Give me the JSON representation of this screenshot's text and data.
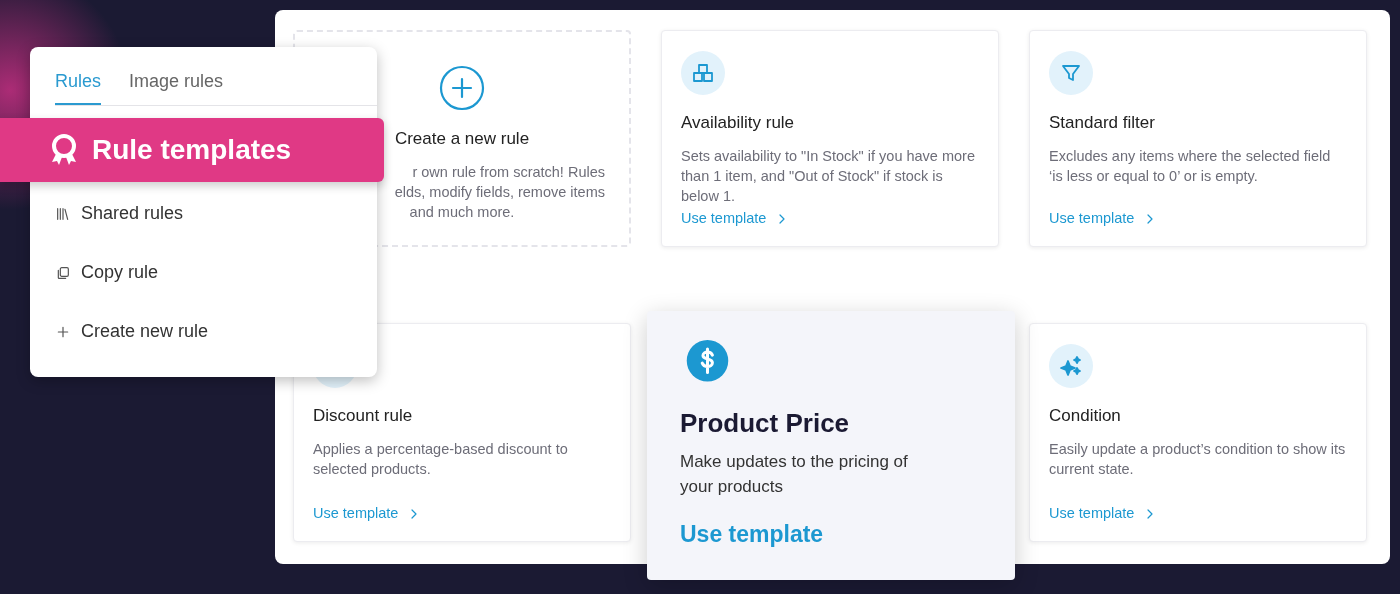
{
  "menu": {
    "tabs": [
      {
        "label": "Rules",
        "selected": true
      },
      {
        "label": "Image rules",
        "selected": false
      }
    ],
    "highlight": {
      "label": "Rule templates"
    },
    "items": [
      {
        "label": "Shared rules"
      },
      {
        "label": "Copy rule"
      },
      {
        "label": "Create new rule"
      }
    ]
  },
  "templates": [
    {
      "kind": "new",
      "title": "Create a new rule",
      "description_lines": [
        "r own rule from scratch! Rules",
        "elds, modify fields, remove items",
        "and much more."
      ]
    },
    {
      "kind": "template",
      "title": "Availability rule",
      "description": "Sets availability to \"In Stock\" if you have more than 1 item, and \"Out of Stock\" if stock is below 1.",
      "link": "Use template"
    },
    {
      "kind": "template",
      "title": "Standard filter",
      "description": "Excludes any items where the selected field ‘is less or equal to 0’ or is empty.",
      "link": "Use template"
    },
    {
      "kind": "template",
      "title": "Discount rule",
      "description": "Applies a percentage-based discount to selected products.",
      "link": "Use template"
    },
    {
      "kind": "featured",
      "title": "Product Price",
      "description": "Make updates to the pricing of your products",
      "link": "Use template"
    },
    {
      "kind": "template",
      "title": "Condition",
      "description": "Easily update a product’s condition to show its current state.",
      "link": "Use template"
    }
  ]
}
